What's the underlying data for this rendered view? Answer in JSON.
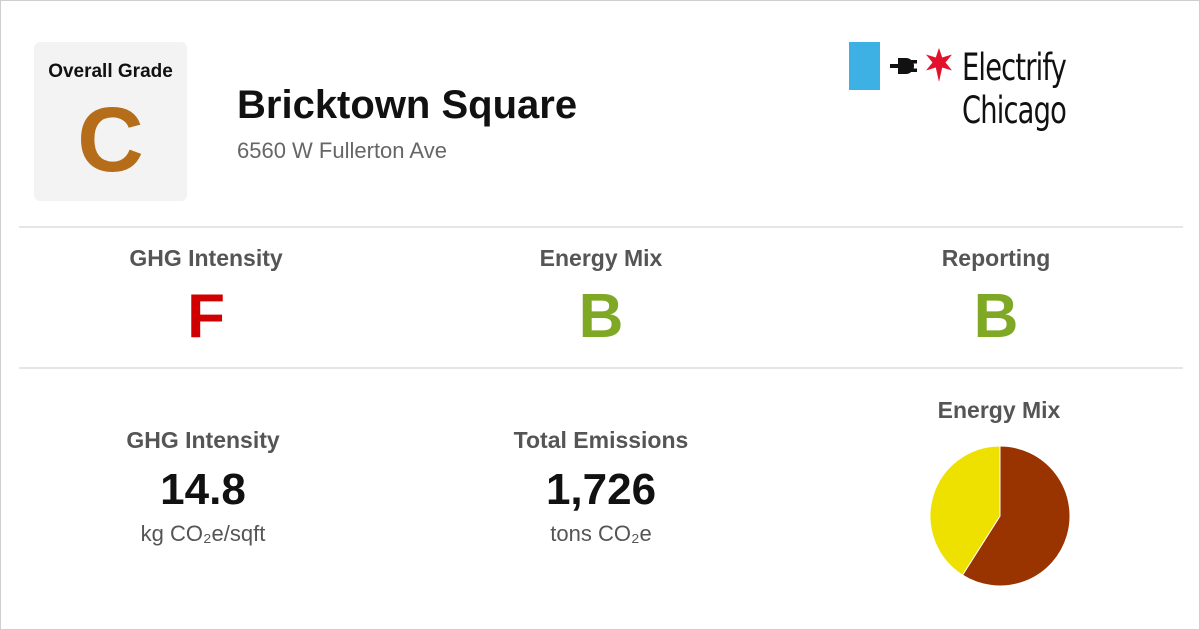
{
  "overall": {
    "label": "Overall Grade",
    "grade": "C"
  },
  "building": {
    "name": "Bricktown Square",
    "address": "6560 W Fullerton Ave"
  },
  "logo": {
    "text": "Electrify Chicago",
    "icons": [
      "plug-icon",
      "chicago-star-icon"
    ]
  },
  "grades": [
    {
      "label": "GHG Intensity",
      "grade": "F",
      "color": "#d00000"
    },
    {
      "label": "Energy Mix",
      "grade": "B",
      "color": "#7fa925"
    },
    {
      "label": "Reporting",
      "grade": "B",
      "color": "#7fa925"
    }
  ],
  "metrics": [
    {
      "label": "GHG Intensity",
      "value": "14.8",
      "unit": "kg CO₂e/sqft"
    },
    {
      "label": "Total Emissions",
      "value": "1,726",
      "unit": "tons CO₂e"
    }
  ],
  "colors": {
    "grade_c": "#b66d1a",
    "logo_blue": "#3db1e3",
    "star_red": "#e3112b"
  },
  "chart_data": {
    "type": "pie",
    "title": "Energy Mix",
    "slices": [
      {
        "value": 59,
        "color": "#993300"
      },
      {
        "value": 41,
        "color": "#eee100"
      }
    ]
  }
}
